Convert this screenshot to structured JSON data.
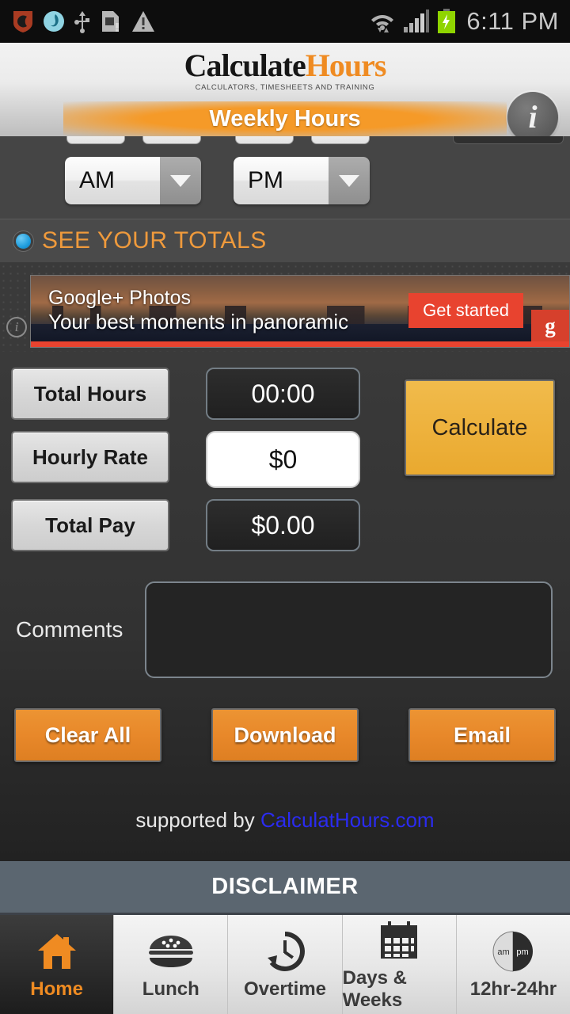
{
  "statusbar": {
    "time": "6:11 PM",
    "left_icons": [
      "shield-icon",
      "app-circle-icon",
      "usb-icon",
      "sd-card-alert-icon",
      "warning-triangle-icon"
    ],
    "right_icons": [
      "wifi-icon",
      "signal-bars-icon",
      "battery-charging-icon"
    ]
  },
  "header": {
    "logo_primary": "Calculate",
    "logo_secondary": "Hours",
    "logo_tagline": "CALCULATORS, TIMESHEETS AND TRAINING",
    "subtitle": "Weekly Hours",
    "info_glyph": "i",
    "accent_orange": "#ef8b22"
  },
  "time_row": {
    "am_value": "AM",
    "pm_value": "PM",
    "options": [
      "AM",
      "PM"
    ]
  },
  "totals": {
    "label": "SEE YOUR TOTALS",
    "radio_color": "#1f9ede",
    "label_color": "#ef9a3c"
  },
  "ad": {
    "title": "Google+ Photos",
    "subtitle": "Your best moments in panoramic",
    "cta": "Get started",
    "brand_mark": "g",
    "info_glyph": "i",
    "cta_color": "#e8432f"
  },
  "calculator": {
    "rows": [
      {
        "label": "Total Hours",
        "value": "00:00",
        "style": "dark"
      },
      {
        "label": "Hourly Rate",
        "value": "$0",
        "style": "white"
      },
      {
        "label": "Total Pay",
        "value": "$0.00",
        "style": "dark"
      }
    ],
    "calculate_label": "Calculate",
    "calculate_color": "#eeb23d",
    "comments_label": "Comments",
    "comments_value": "",
    "comments_placeholder": ""
  },
  "actions": {
    "clear": "Clear All",
    "download": "Download",
    "email": "Email",
    "button_color": "#e8882a"
  },
  "footer": {
    "credit_prefix": "supported by ",
    "credit_link": "CalculatHours.com",
    "link_color": "#2b2bf0",
    "disclaimer": "DISCLAIMER",
    "disclaimer_bg": "#5b6670"
  },
  "tabs": [
    {
      "label": "Home",
      "icon": "home-icon",
      "active": true
    },
    {
      "label": "Lunch",
      "icon": "burger-icon",
      "active": false
    },
    {
      "label": "Overtime",
      "icon": "clock-arrow-icon",
      "active": false
    },
    {
      "label": "Days & Weeks",
      "icon": "calendar-icon",
      "active": false
    },
    {
      "label": "12hr-24hr",
      "icon": "am-pm-circle-icon",
      "active": false
    }
  ]
}
